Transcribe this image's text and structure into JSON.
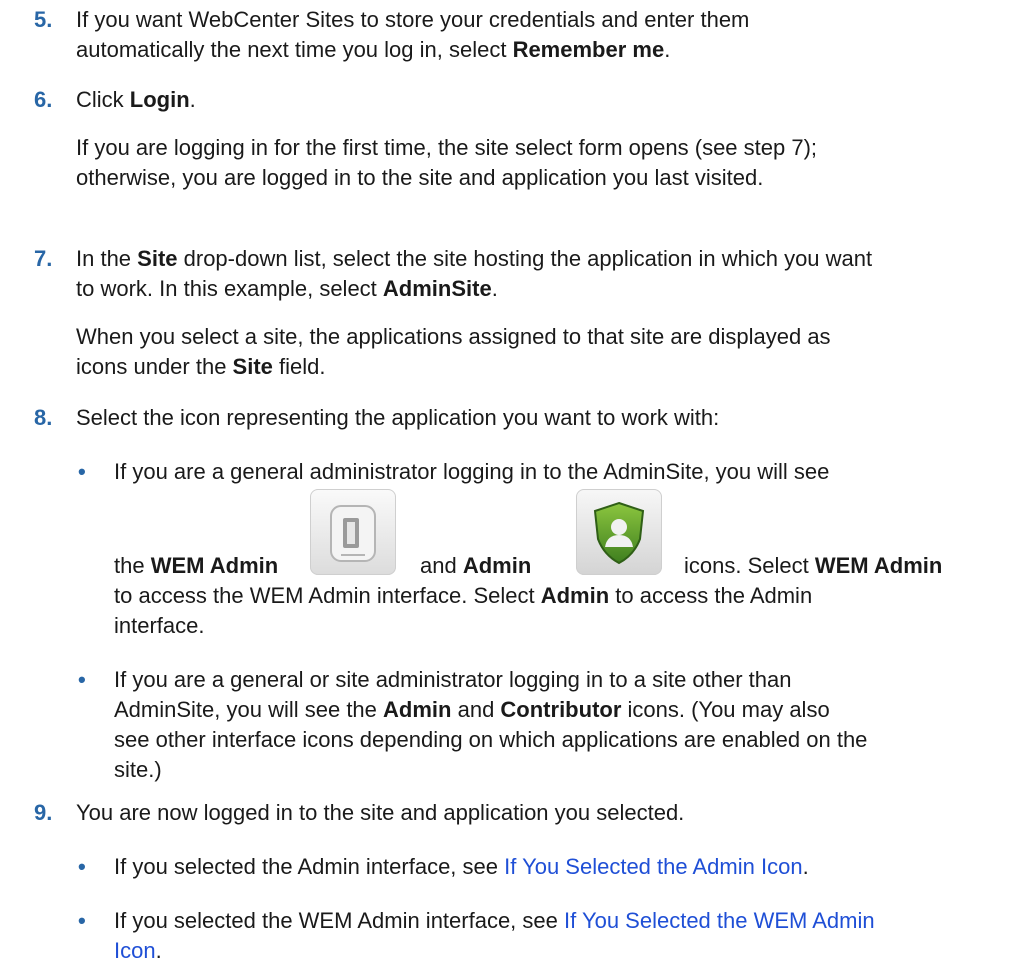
{
  "step5": {
    "num": "5.",
    "line1": "If you want WebCenter Sites to store your credentials and enter them",
    "line2_pre": "automatically the next time you log in, select ",
    "line2_bold": "Remember me",
    "line2_post": "."
  },
  "step6": {
    "num": "6.",
    "pre": "Click ",
    "bold": "Login",
    "post": ".",
    "note_line1": "If you are logging in for the first time, the site select form opens (see step 7);",
    "note_line2": "otherwise, you are logged in to the site and application you last visited."
  },
  "step7": {
    "num": "7.",
    "line1_pre": "In the ",
    "line1_bold": "Site",
    "line1_post": " drop-down list, select the site hosting the application in which you want",
    "line2_pre": "to work. In this example, select ",
    "line2_bold": "AdminSite",
    "line2_post": ".",
    "note_line1": "When you select a site, the applications assigned to that site are displayed as",
    "note_line2_pre": "icons under the ",
    "note_line2_bold": "Site",
    "note_line2_post": " field."
  },
  "step8": {
    "num": "8.",
    "text": "Select the icon representing the application you want to work with:",
    "bullet1": {
      "line1": "If you are a general administrator logging in to the AdminSite, you will see",
      "the": "the ",
      "wem_admin_bold": "WEM Admin",
      "and": "and ",
      "admin_bold": "Admin",
      "icons_select": "icons. Select ",
      "wem_admin_bold2": "WEM Admin",
      "line3_pre": "to access the WEM Admin interface. Select ",
      "line3_bold": "Admin",
      "line3_post": " to access the Admin",
      "line4": "interface."
    },
    "bullet2": {
      "line1": "If you are a general or site administrator logging in to a site other than",
      "line2_pre": "AdminSite, you will see the ",
      "line2_bold1": "Admin",
      "line2_mid": " and ",
      "line2_bold2": "Contributor",
      "line2_post": " icons. (You may also",
      "line3": "see other interface icons depending on which applications are enabled on the",
      "line4": "site.)"
    }
  },
  "step9": {
    "num": "9.",
    "text": "You are now logged in to the site and application you selected.",
    "bullet1_pre": "If you selected the Admin interface, see ",
    "bullet1_link": "If You Selected the Admin Icon",
    "bullet1_post": ".",
    "bullet2_pre": "If you selected the WEM Admin interface, see ",
    "bullet2_link_part1": "If You Selected the WEM Admin",
    "bullet2_link_part2": "Icon",
    "bullet2_post": "."
  },
  "bullet_char": "•",
  "colors": {
    "accent": "#2866a6",
    "link": "#1f4fd6",
    "text": "#1a1a1a"
  },
  "icons": [
    "wem-admin-icon",
    "admin-shield-icon"
  ]
}
